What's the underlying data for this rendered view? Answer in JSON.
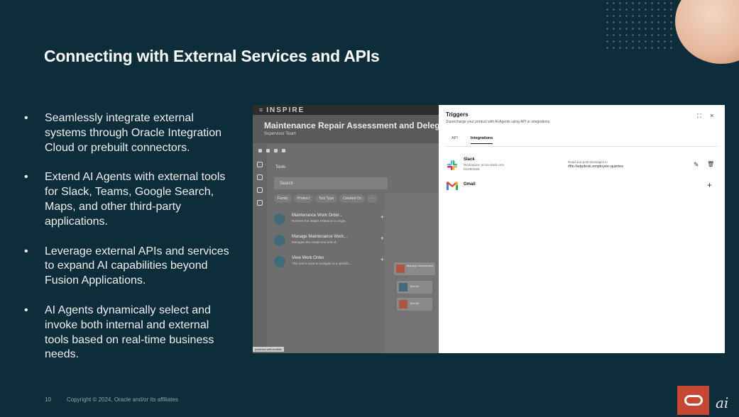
{
  "slide": {
    "title": "Connecting with External Services and APIs",
    "bullets": [
      "Seamlessly integrate external systems through Oracle Integration Cloud or prebuilt connectors.",
      "Extend AI Agents with external tools for Slack, Teams, Google Search, Maps, and other third-party applications.",
      "Leverage external APIs and services to expand AI capabilities beyond Fusion Applications.",
      "AI Agents dynamically select and invoke both internal and external tools based on real-time business needs."
    ],
    "bullet_glyph": "•",
    "page_number": "10",
    "copyright": "Copyright © 2024, Oracle and/or its affiliates",
    "logo_icon": "oracle-logo",
    "watermark": "ai",
    "colors": {
      "background": "#0e2d3a",
      "oracle_red": "#c74634"
    }
  },
  "app": {
    "menu_icon": "≡",
    "brand": "INSPIRE",
    "page_title": "Maintenance Repair Assessment and Delega",
    "page_subtitle": "Supervisor Team",
    "tools_label": "Tools",
    "search_placeholder": "Search",
    "filters": [
      "Family",
      "Product",
      "Tool Type",
      "Created On"
    ],
    "filters_more": "···",
    "tools": [
      {
        "name": "Maintenance Work Order...",
        "desc": "Retrieve the details related to a single..."
      },
      {
        "name": "Manage Maintenance Work...",
        "desc": "Manages the create and edit of..."
      },
      {
        "name": "View Work Order",
        "desc": "This tool is used to navigate to a specific..."
      }
    ],
    "add_glyph": "+",
    "flow_nodes": [
      "Manage Assessment",
      "Tool-01",
      "Tool-02"
    ],
    "status_chip": "powered-with-toolkits"
  },
  "triggers": {
    "title": "Triggers",
    "subtitle": "Supercharge your product with AI Agents using API or integrations",
    "expand_glyph": "⛶",
    "close_glyph": "×",
    "tabs": [
      "API",
      "Integrations"
    ],
    "active_tab": "Integrations",
    "slack": {
      "name": "Slack",
      "workspace": "Workspace: acme.slack.com",
      "date": "01/28/2025",
      "read_label": "Read and post messages in",
      "channel": "#fin-helpdesk.employee-queries"
    },
    "gmail": {
      "name": "Gmail"
    },
    "edit_glyph": "✎",
    "delete_glyph": "🗑",
    "add_glyph": "+"
  }
}
